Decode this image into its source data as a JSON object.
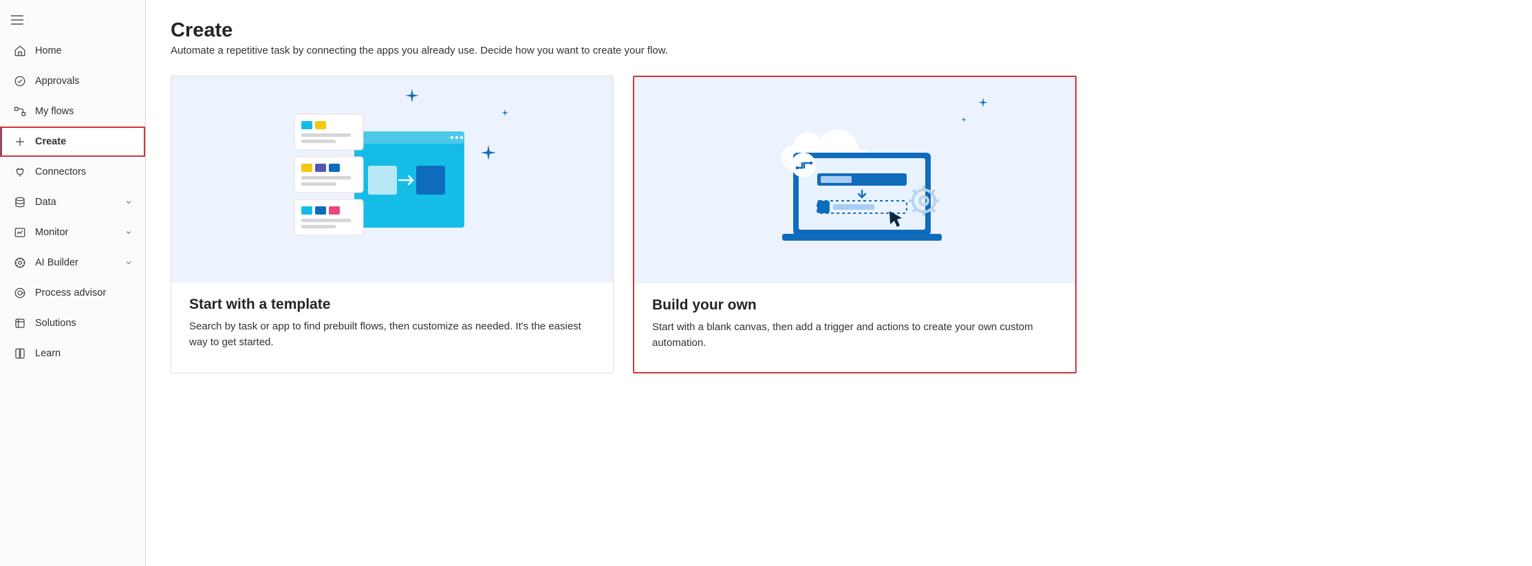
{
  "sidebar": {
    "items": [
      {
        "label": "Home"
      },
      {
        "label": "Approvals"
      },
      {
        "label": "My flows"
      },
      {
        "label": "Create"
      },
      {
        "label": "Connectors"
      },
      {
        "label": "Data"
      },
      {
        "label": "Monitor"
      },
      {
        "label": "AI Builder"
      },
      {
        "label": "Process advisor"
      },
      {
        "label": "Solutions"
      },
      {
        "label": "Learn"
      }
    ]
  },
  "page": {
    "title": "Create",
    "subtitle": "Automate a repetitive task by connecting the apps you already use. Decide how you want to create your flow."
  },
  "cards": [
    {
      "title": "Start with a template",
      "desc": "Search by task or app to find prebuilt flows, then customize as needed. It's the easiest way to get started."
    },
    {
      "title": "Build your own",
      "desc": "Start with a blank canvas, then add a trigger and actions to create your own custom automation."
    }
  ]
}
